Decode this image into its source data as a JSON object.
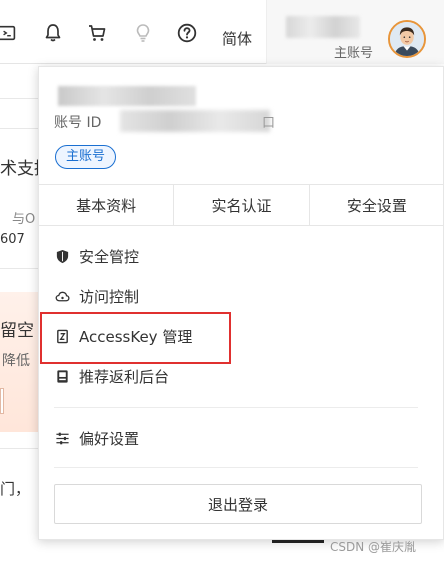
{
  "topbar": {
    "icons": [
      "terminal-icon",
      "bell-icon",
      "cart-icon",
      "lightbulb-icon",
      "help-icon"
    ],
    "language": "简体",
    "account_subtitle": "主账号"
  },
  "background": {
    "frag1": "术支持",
    "frag2": "与O",
    "frag3": "607",
    "frag4": "留空",
    "frag5": "降低",
    "frag6": "门，"
  },
  "dropdown": {
    "account_id_label": "账号 ID",
    "account_id_tail": "口",
    "role_badge": "主账号",
    "tabs": [
      {
        "label": "基本资料"
      },
      {
        "label": "实名认证"
      },
      {
        "label": "安全设置"
      }
    ],
    "menu": [
      {
        "label": "安全管控",
        "icon": "shield-icon"
      },
      {
        "label": "访问控制",
        "icon": "cloud-icon"
      },
      {
        "label": "AccessKey 管理",
        "icon": "key-icon"
      },
      {
        "label": "推荐返利后台",
        "icon": "gift-icon"
      },
      {
        "label": "偏好设置",
        "icon": "sliders-icon"
      }
    ],
    "logout_label": "退出登录"
  },
  "watermark": "CSDN @崔庆胤",
  "colors": {
    "accent_blue": "#1a6fd1",
    "highlight_red": "#e0302f",
    "avatar_ring": "#e8953a"
  }
}
